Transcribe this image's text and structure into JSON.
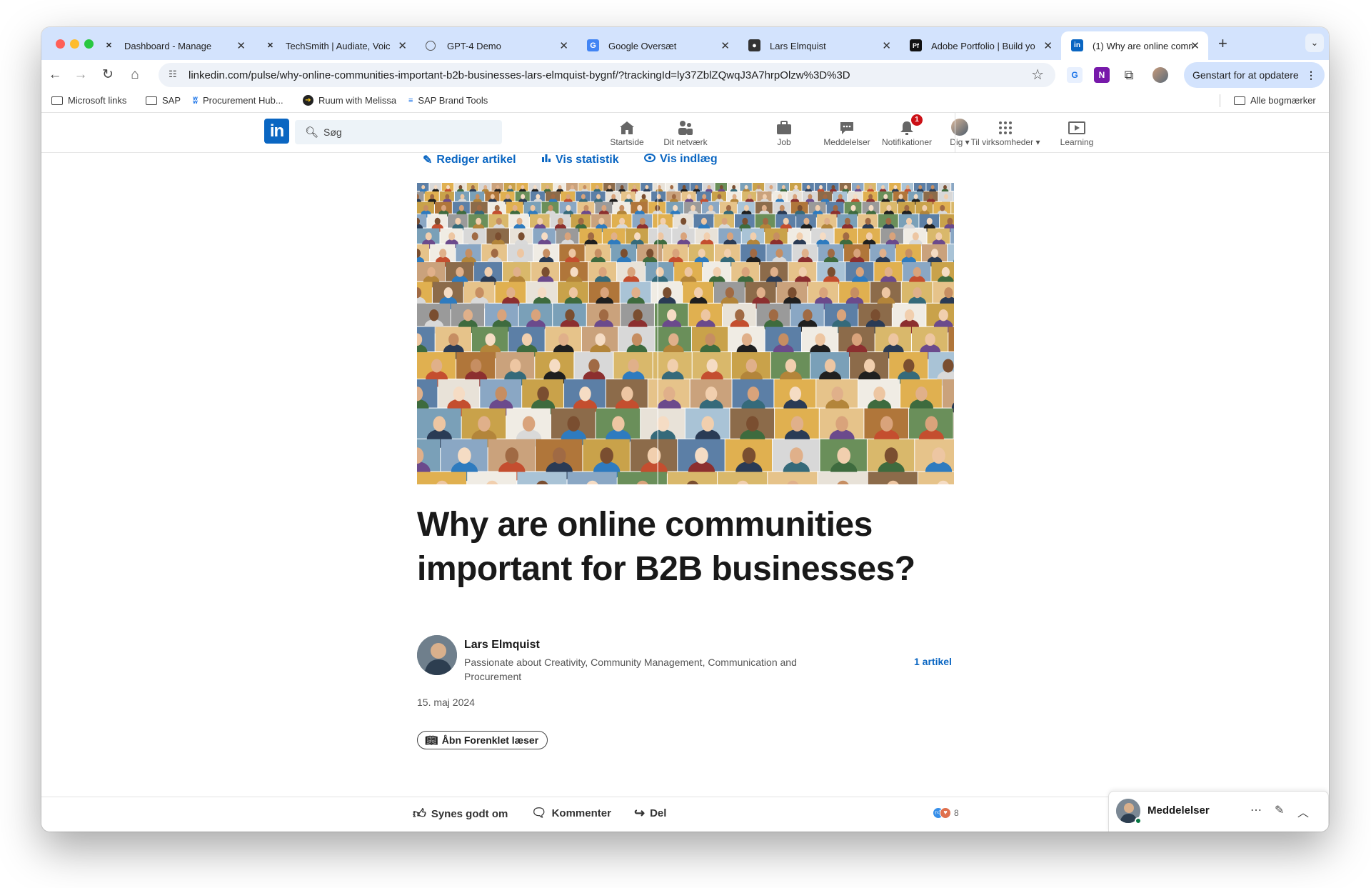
{
  "browser": {
    "tabs": [
      {
        "title": "Dashboard - Manage",
        "favicon": "x-logo-icon",
        "active": false
      },
      {
        "title": "TechSmith | Audiate, Voic",
        "favicon": "x-logo-icon",
        "active": false
      },
      {
        "title": "GPT-4 Demo",
        "favicon": "globe-icon",
        "active": false
      },
      {
        "title": "Google Oversæt",
        "favicon": "google-translate-icon",
        "active": false
      },
      {
        "title": "Lars Elmquist",
        "favicon": "person-icon",
        "active": false
      },
      {
        "title": "Adobe Portfolio | Build yo",
        "favicon": "adobe-portfolio-icon",
        "active": false
      },
      {
        "title": "(1) Why are online comm",
        "favicon": "linkedin-icon",
        "active": true
      }
    ],
    "url": "linkedin.com/pulse/why-online-communities-important-b2b-businesses-lars-elmquist-bygnf/?trackingId=ly37ZblZQwqJ3A7hrpOlzw%3D%3D",
    "restart_label": "Genstart for at opdatere",
    "bookmarks": [
      {
        "label": "Microsoft links",
        "icon": "folder-icon"
      },
      {
        "label": "SAP",
        "icon": "folder-icon"
      },
      {
        "label": "Procurement Hub...",
        "icon": "butterfly-icon"
      },
      {
        "label": "Ruum with Melissa",
        "icon": "arrow-circle-icon"
      },
      {
        "label": "SAP Brand Tools",
        "icon": "sap-icon"
      }
    ],
    "all_bookmarks_label": "Alle bogmærker"
  },
  "linkedin": {
    "logo": "in",
    "search_placeholder": "Søg",
    "nav": [
      {
        "label": "Startside",
        "icon": "home-icon"
      },
      {
        "label": "Dit netværk",
        "icon": "network-icon"
      },
      {
        "label": "Job",
        "icon": "briefcase-icon"
      },
      {
        "label": "Meddelelser",
        "icon": "messaging-icon"
      },
      {
        "label": "Notifikationer",
        "icon": "bell-icon",
        "badge": "1"
      },
      {
        "label": "Dig",
        "icon": "avatar-icon"
      },
      {
        "label": "Til virksomheder",
        "icon": "grid-icon"
      },
      {
        "label": "Learning",
        "icon": "learning-icon"
      }
    ]
  },
  "article": {
    "actions": [
      "Rediger artikel",
      "Vis statistik",
      "Vis indlæg"
    ],
    "title": "Why are online communities important for B2B businesses?",
    "author_name": "Lars Elmquist",
    "author_headline": "Passionate about Creativity, Community Management, Communication and Procurement",
    "article_count": "1 artikel",
    "date": "15. maj 2024",
    "reader_button": "Åbn Forenklet læser"
  },
  "social_bar": {
    "like": "Synes godt om",
    "comment": "Kommenter",
    "share": "Del",
    "reaction_count": "8"
  },
  "messaging": {
    "title": "Meddelelser"
  },
  "colors": {
    "linkedin_blue": "#0a66c2",
    "tabstrip": "#d3e3fd",
    "notification_red": "#cc1016"
  }
}
